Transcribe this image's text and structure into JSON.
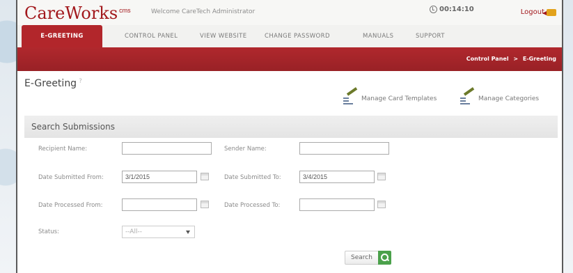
{
  "header": {
    "logo": "CareWorks",
    "logo_sup": "cms",
    "welcome": "Welcome CareTech Administrator",
    "timer": "00:14:10",
    "logout": "Logout"
  },
  "nav": {
    "items": [
      "E-GREETING",
      "CONTROL PANEL",
      "VIEW WEBSITE",
      "CHANGE PASSWORD",
      "MANUALS",
      "SUPPORT"
    ],
    "active": "E-GREETING"
  },
  "breadcrumb": {
    "parent": "Control Panel",
    "separator": ">",
    "current": "E-Greeting"
  },
  "page": {
    "title": "E-Greeting",
    "help": "?",
    "manage_templates": "Manage Card Templates",
    "manage_categories": "Manage Categories"
  },
  "search": {
    "heading": "Search Submissions",
    "recipient_label": "Recipient Name:",
    "recipient_value": "",
    "sender_label": "Sender Name:",
    "sender_value": "",
    "submitted_from_label": "Date Submitted From:",
    "submitted_from_value": "3/1/2015",
    "submitted_to_label": "Date Submitted To:",
    "submitted_to_value": "3/4/2015",
    "processed_from_label": "Date Processed From:",
    "processed_from_value": "",
    "processed_to_label": "Date Processed To:",
    "processed_to_value": "",
    "status_label": "Status:",
    "status_value": "--All--",
    "button": "Search"
  },
  "colors": {
    "brand_red": "#a2181c",
    "bar_red": "#b0282d",
    "search_green": "#4ba14b"
  }
}
